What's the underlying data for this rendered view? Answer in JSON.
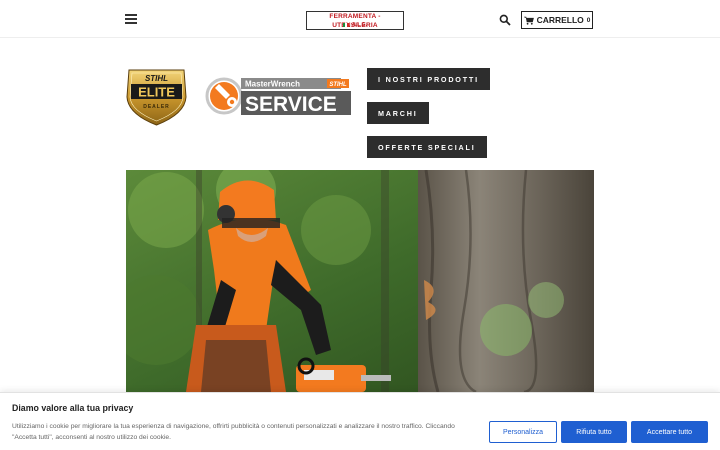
{
  "header": {
    "logo_line1": "FERRAMENTA - UTENSILERIA",
    "logo_line2": "A.L.G.",
    "cart_label": "CARRELLO",
    "cart_count": "0"
  },
  "logos": {
    "elite_top": "STIHL",
    "elite_main": "ELITE",
    "elite_bottom": "DEALER",
    "service_top": "MasterWrench",
    "service_brand": "STIHL",
    "service_main": "SERVICE"
  },
  "nav": {
    "products": "I NOSTRI PRODOTTI",
    "brands": "MARCHI",
    "offers": "OFFERTE SPECIALI"
  },
  "cookie": {
    "title": "Diamo valore alla tua privacy",
    "text": "Utilizziamo i cookie per migliorare la tua esperienza di navigazione, offrirti pubblicità o contenuti personalizzati e analizzare il nostro traffico. Cliccando \"Accetta tutti\", acconsenti al nostro utilizzo dei cookie.",
    "customize": "Personalizza",
    "reject": "Rifiuta tutto",
    "accept": "Accettare tutto"
  },
  "colors": {
    "accent": "#1f5fd1",
    "nav_bg": "#2d2d2d",
    "stihl_orange": "#f37a1f"
  },
  "icons": [
    "hamburger-menu-icon",
    "search-icon",
    "cart-icon"
  ]
}
